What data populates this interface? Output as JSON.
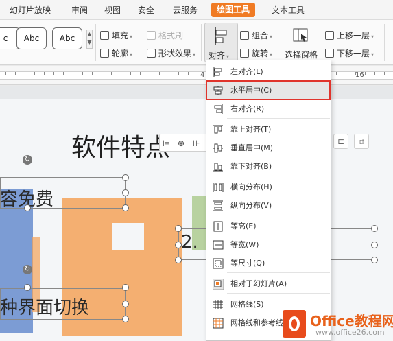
{
  "tabs": [
    "幻灯片放映",
    "审阅",
    "视图",
    "安全",
    "云服务",
    "绘图工具",
    "文本工具"
  ],
  "active_tab": "绘图工具",
  "ribbon": {
    "styles": [
      "c",
      "Abc",
      "Abc"
    ],
    "fill": "填充",
    "format_painter": "格式刷",
    "outline": "轮廓",
    "shape_effects": "形状效果",
    "align": "对齐",
    "group": "组合",
    "rotate": "旋转",
    "selection_pane": "选择窗格",
    "bring_forward": "上移一层",
    "send_backward": "下移一层"
  },
  "ruler": {
    "numbers": [
      "4",
      "16"
    ]
  },
  "slide": {
    "title": "软件特点",
    "text_1": "容免费",
    "text_2": "2.",
    "text_3": "种界面切换"
  },
  "menu": {
    "items": [
      {
        "label": "左对齐(L)",
        "icon": "align-left-icon"
      },
      {
        "label": "水平居中(C)",
        "icon": "align-center-icon"
      },
      {
        "label": "右对齐(R)",
        "icon": "align-right-icon"
      },
      {
        "label": "靠上对齐(T)",
        "icon": "align-top-icon"
      },
      {
        "label": "垂直居中(M)",
        "icon": "align-middle-icon"
      },
      {
        "label": "靠下对齐(B)",
        "icon": "align-bottom-icon"
      },
      {
        "label": "横向分布(H)",
        "icon": "distribute-horizontal-icon"
      },
      {
        "label": "纵向分布(V)",
        "icon": "distribute-vertical-icon"
      },
      {
        "label": "等高(E)",
        "icon": "same-height-icon"
      },
      {
        "label": "等宽(W)",
        "icon": "same-width-icon"
      },
      {
        "label": "等尺寸(Q)",
        "icon": "same-size-icon"
      },
      {
        "label": "相对于幻灯片(A)",
        "icon": "relative-to-slide-icon"
      },
      {
        "label": "网格线(S)",
        "icon": "gridlines-icon"
      },
      {
        "label": "网格线和参考线",
        "icon": "gridlines-guides-icon"
      }
    ],
    "highlighted": "水平居中(C)"
  },
  "watermark": {
    "title": "Office教程网",
    "url": "www.office26.com"
  },
  "colors": {
    "accent": "#f07b24",
    "highlight_border": "#e0342c",
    "slide_orange": "#f3a259",
    "slide_blue": "#6f92cf",
    "slide_green": "#a9c98a"
  }
}
